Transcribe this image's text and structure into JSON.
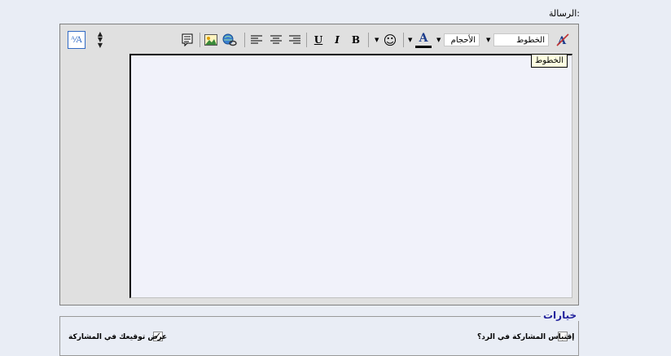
{
  "message_label": "الرسالة:",
  "toolbar": {
    "font_select": "الخطوط",
    "size_select": "الأحجام",
    "font_color_glyph": "A",
    "bold": "B",
    "italic": "I",
    "underline": "U",
    "smilie": "☺"
  },
  "tooltip": "الخطوط",
  "options": {
    "legend": "خيارات",
    "quote_label": "إقتباس المشاركة في الرد؟",
    "quote_checked": false,
    "signature_label": "عرض توقيعك في المشاركة",
    "signature_checked": true
  }
}
